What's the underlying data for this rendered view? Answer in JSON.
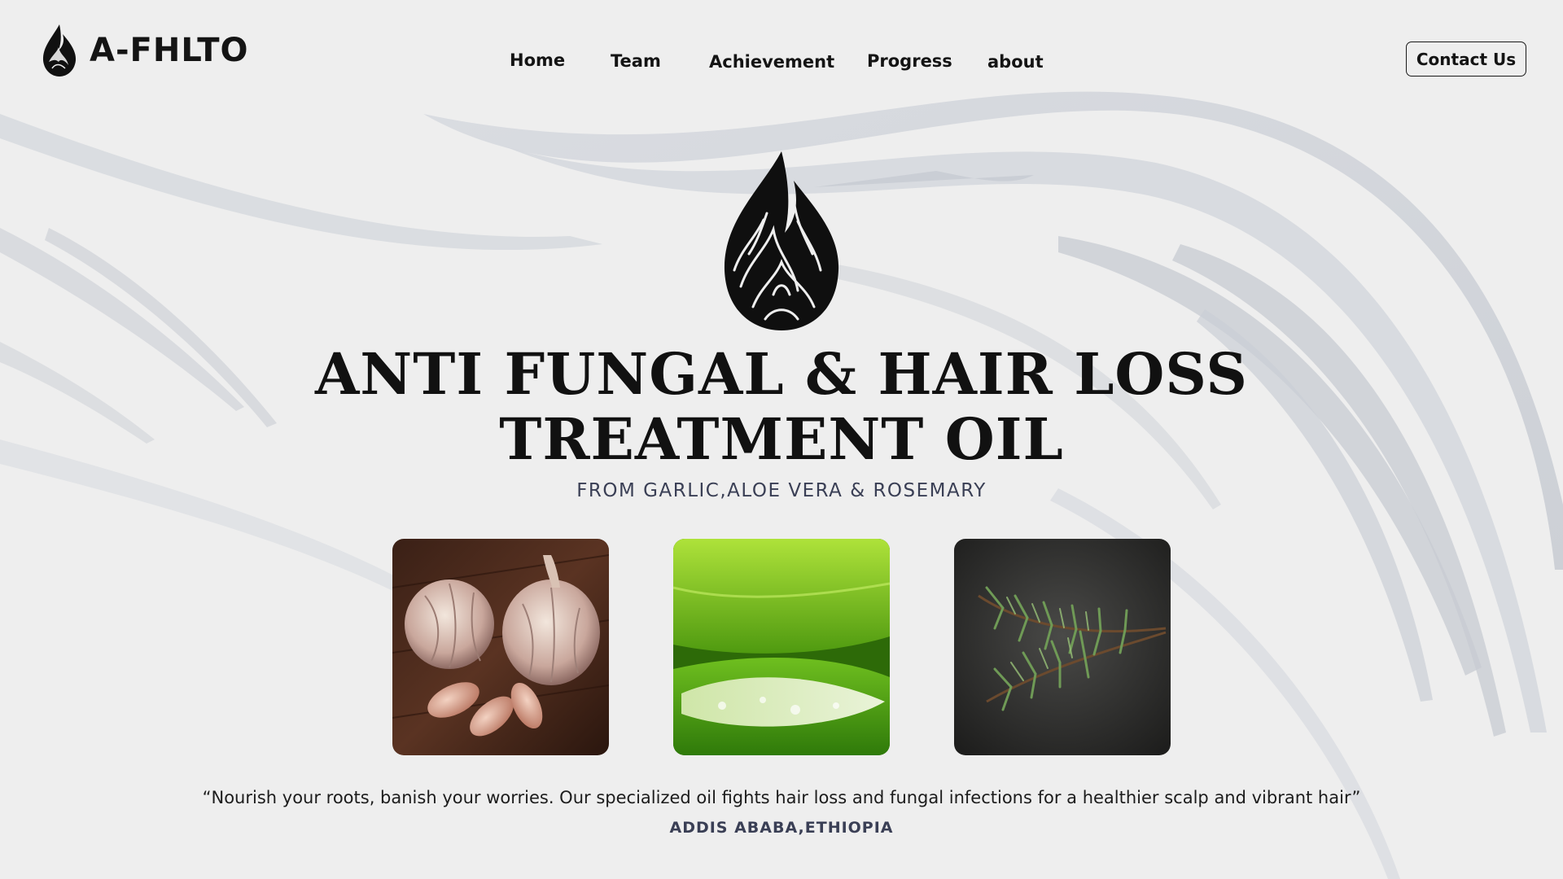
{
  "brand": {
    "name": "A-FHLTO",
    "logo_icon": "oil-drop-flame-icon"
  },
  "nav": {
    "items": [
      {
        "label": "Home"
      },
      {
        "label": "Team"
      },
      {
        "label": "Achievement"
      },
      {
        "label": "Progress"
      },
      {
        "label": "about"
      }
    ],
    "contact_label": "Contact Us"
  },
  "hero": {
    "icon": "oil-drop-flame-icon",
    "title_line1": "ANTI FUNGAL & HAIR LOSS",
    "title_line2": "TREATMENT OIL",
    "subtitle": "FROM GARLIC,ALOE VERA & ROSEMARY"
  },
  "ingredients": [
    {
      "image": "garlic-photo"
    },
    {
      "image": "aloe-vera-photo"
    },
    {
      "image": "rosemary-photo"
    }
  ],
  "quote": "“Nourish your roots, banish your worries. Our specialized oil fights hair loss and fungal infections for a healthier scalp and vibrant hair”",
  "location": "ADDIS ABABA,ETHIOPIA",
  "colors": {
    "background": "#eeeeee",
    "swirl": "#c9ccd3",
    "text": "#141414",
    "subtitle": "#3a3f55"
  }
}
